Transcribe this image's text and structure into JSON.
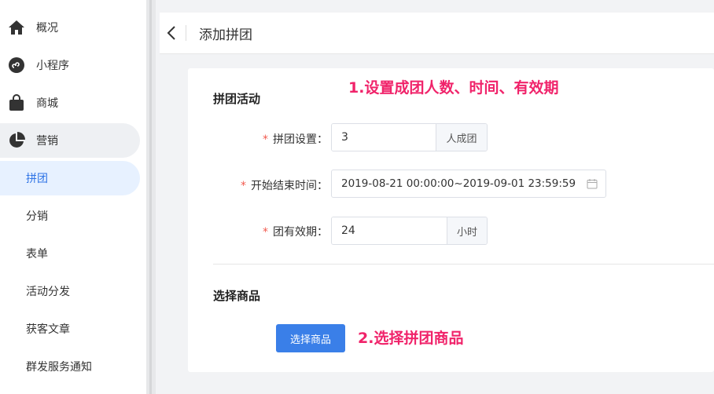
{
  "sidebar": {
    "items": [
      {
        "label": "概况",
        "icon": "home-icon"
      },
      {
        "label": "小程序",
        "icon": "mini-program-icon"
      },
      {
        "label": "商城",
        "icon": "shopping-bag-icon"
      },
      {
        "label": "营销",
        "icon": "pie-chart-icon"
      }
    ],
    "sub_items": [
      {
        "label": "拼团"
      },
      {
        "label": "分销"
      },
      {
        "label": "表单"
      },
      {
        "label": "活动分发"
      },
      {
        "label": "获客文章"
      },
      {
        "label": "群发服务通知"
      }
    ]
  },
  "header": {
    "title": "添加拼团"
  },
  "form": {
    "section1_title": "拼团活动",
    "group_size": {
      "label": "拼团设置：",
      "value": "3",
      "addon": "人成团"
    },
    "time_range": {
      "label": "开始结束时间：",
      "start": "2019-08-21 00:00:00",
      "separator": "~",
      "end": "2019-09-01 23:59:59"
    },
    "valid_period": {
      "label": "团有效期：",
      "value": "24",
      "addon": "小时"
    },
    "required_mark": "*",
    "section2_title": "选择商品",
    "select_button": "选择商品"
  },
  "annotations": {
    "note1": "1.设置成团人数、时间、有效期",
    "note2": "2.选择拼团商品",
    "color": "#f0236a"
  },
  "colors": {
    "primary": "#3a7fe8",
    "active_bg": "#e7f1ff",
    "required": "#f25a4f"
  }
}
